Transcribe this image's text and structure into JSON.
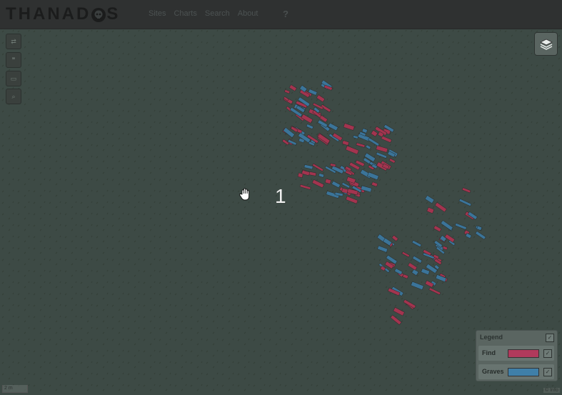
{
  "app": {
    "logo_text": "THANADOS"
  },
  "nav": {
    "items": [
      "Sites",
      "Charts",
      "Search",
      "About"
    ],
    "help_glyph": "?"
  },
  "map_controls": [
    {
      "name": "swap-icon",
      "glyph": "⇄"
    },
    {
      "name": "quote-icon",
      "glyph": "❞"
    },
    {
      "name": "card-icon",
      "glyph": "▭"
    },
    {
      "name": "search-icon",
      "glyph": "⌕"
    }
  ],
  "overlay": {
    "step_number": "1"
  },
  "legend": {
    "title": "Legend",
    "items": [
      {
        "label": "Find",
        "color": "#b03a5c"
      },
      {
        "label": "Graves",
        "color": "#3f7fa8"
      }
    ]
  },
  "scale": {
    "label": "2 m"
  },
  "attribution": {
    "label": "© Info"
  },
  "colors": {
    "find": "#a3344f",
    "grave": "#3b7499",
    "map_bg": "#3d4a45"
  }
}
